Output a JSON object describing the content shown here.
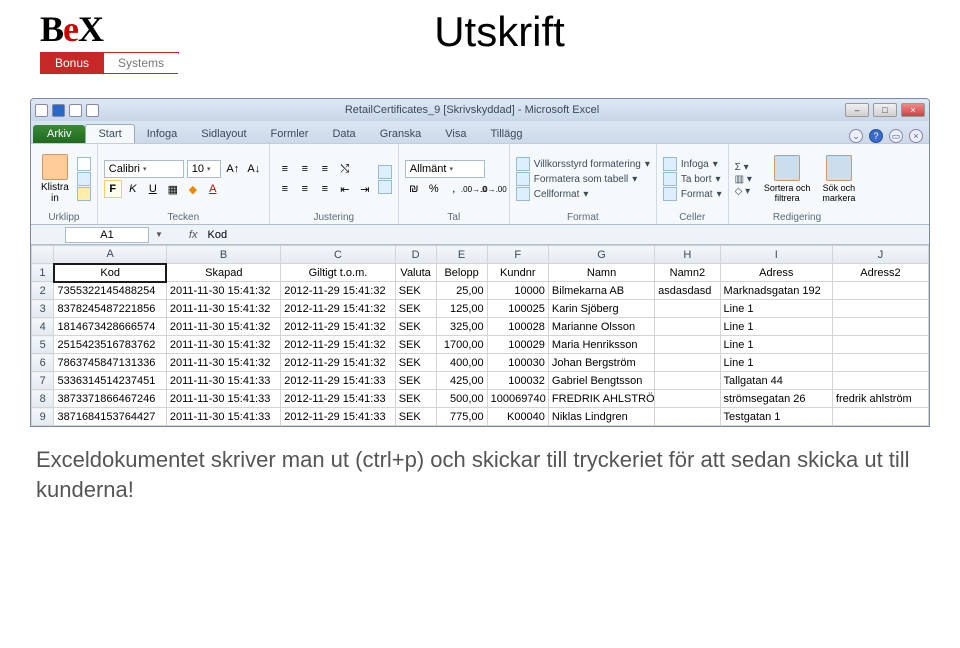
{
  "logo": {
    "brand": "BeX",
    "tab1": "Bonus",
    "tab2": "Systems"
  },
  "doc_title": "Utskrift",
  "window": {
    "title": "RetailCertificates_9  [Skrivskyddad]  -  Microsoft Excel"
  },
  "ribbon_tabs": {
    "file": "Arkiv",
    "items": [
      "Start",
      "Infoga",
      "Sidlayout",
      "Formler",
      "Data",
      "Granska",
      "Visa",
      "Tillägg"
    ]
  },
  "ribbon": {
    "clipboard": {
      "paste": "Klistra\nin",
      "group": "Urklipp"
    },
    "font": {
      "name": "Calibri",
      "size": "10",
      "group": "Tecken"
    },
    "align": {
      "group": "Justering"
    },
    "number": {
      "style": "Allmänt",
      "group": "Tal"
    },
    "styles": {
      "cond": "Villkorsstyrd formatering",
      "table": "Formatera som tabell",
      "cell": "Cellformat",
      "group": "Format"
    },
    "cells": {
      "insert": "Infoga",
      "delete": "Ta bort",
      "format": "Format",
      "group": "Celler"
    },
    "editing": {
      "sort": "Sortera och\nfiltrera",
      "find": "Sök och\nmarkera",
      "group": "Redigering"
    }
  },
  "namebox": {
    "ref": "A1",
    "fx": "fx",
    "formula": "Kod"
  },
  "columns": [
    "A",
    "B",
    "C",
    "D",
    "E",
    "F",
    "G",
    "H",
    "I",
    "J"
  ],
  "headers": [
    "Kod",
    "Skapad",
    "Giltigt t.o.m.",
    "Valuta",
    "Belopp",
    "Kundnr",
    "Namn",
    "Namn2",
    "Adress",
    "Adress2"
  ],
  "rows": [
    {
      "n": "2",
      "c": [
        "7355322145488254",
        "2011-11-30 15:41:32",
        "2012-11-29 15:41:32",
        "SEK",
        "25,00",
        "10000",
        "Bilmekarna AB",
        "asdasdasd",
        "Marknadsgatan 192",
        ""
      ]
    },
    {
      "n": "3",
      "c": [
        "8378245487221856",
        "2011-11-30 15:41:32",
        "2012-11-29 15:41:32",
        "SEK",
        "125,00",
        "100025",
        "Karin Sjöberg",
        "",
        "Line 1",
        ""
      ]
    },
    {
      "n": "4",
      "c": [
        "1814673428666574",
        "2011-11-30 15:41:32",
        "2012-11-29 15:41:32",
        "SEK",
        "325,00",
        "100028",
        "Marianne Olsson",
        "",
        "Line 1",
        ""
      ]
    },
    {
      "n": "5",
      "c": [
        "2515423516783762",
        "2011-11-30 15:41:32",
        "2012-11-29 15:41:32",
        "SEK",
        "1700,00",
        "100029",
        "Maria Henriksson",
        "",
        "Line 1",
        ""
      ]
    },
    {
      "n": "6",
      "c": [
        "7863745847131336",
        "2011-11-30 15:41:32",
        "2012-11-29 15:41:32",
        "SEK",
        "400,00",
        "100030",
        "Johan Bergström",
        "",
        "Line 1",
        ""
      ]
    },
    {
      "n": "7",
      "c": [
        "5336314514237451",
        "2011-11-30 15:41:33",
        "2012-11-29 15:41:33",
        "SEK",
        "425,00",
        "100032",
        "Gabriel Bengtsson",
        "",
        "Tallgatan 44",
        ""
      ]
    },
    {
      "n": "8",
      "c": [
        "3873371866467246",
        "2011-11-30 15:41:33",
        "2012-11-29 15:41:33",
        "SEK",
        "500,00",
        "100069740",
        "FREDRIK AHLSTRÖM",
        "",
        "strömsegatan 26",
        "fredrik ahlström"
      ]
    },
    {
      "n": "9",
      "c": [
        "3871684153764427",
        "2011-11-30 15:41:33",
        "2012-11-29 15:41:33",
        "SEK",
        "775,00",
        "K00040",
        "Niklas Lindgren",
        "",
        "Testgatan 1",
        ""
      ]
    }
  ],
  "body_text": "Exceldokumentet skriver man ut (ctrl+p) och skickar till tryckeriet för att sedan skicka ut till kunderna!"
}
